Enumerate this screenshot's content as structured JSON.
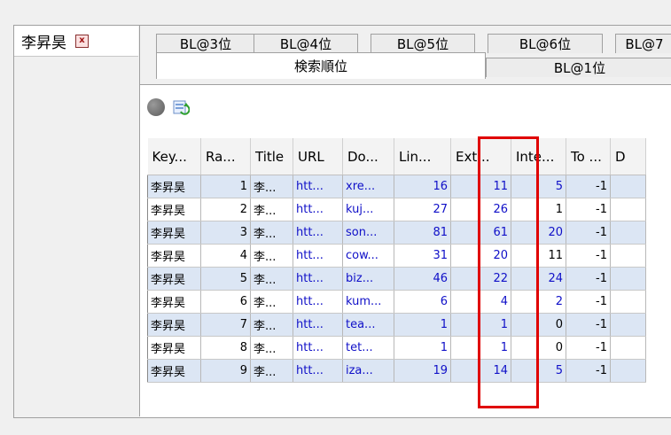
{
  "person": {
    "name": "李昇昊",
    "close_label": "x"
  },
  "tabs_row1": [
    "BL@3位",
    "BL@4位",
    "BL@5位",
    "BL@6位",
    "BL@7"
  ],
  "tabs_row2": [
    "検索順位",
    "BL@1位"
  ],
  "active_tab": "検索順位",
  "toolbar": {
    "icons": [
      "gray-circle-icon",
      "refresh-icon"
    ]
  },
  "table": {
    "columns": [
      "Key...",
      "Ra...",
      "Title",
      "URL",
      "Do...",
      "Lin...",
      "Ext...",
      "Inte...",
      "To ...",
      "D"
    ],
    "rows": [
      [
        "李昇昊",
        "1",
        "李...",
        "htt...",
        "xre...",
        "16",
        "11",
        "5",
        "-1"
      ],
      [
        "李昇昊",
        "2",
        "李...",
        "htt...",
        "kuj...",
        "27",
        "26",
        "1",
        "-1"
      ],
      [
        "李昇昊",
        "3",
        "李...",
        "htt...",
        "son...",
        "81",
        "61",
        "20",
        "-1"
      ],
      [
        "李昇昊",
        "4",
        "李...",
        "htt...",
        "cow...",
        "31",
        "20",
        "11",
        "-1"
      ],
      [
        "李昇昊",
        "5",
        "李...",
        "htt...",
        "biz...",
        "46",
        "22",
        "24",
        "-1"
      ],
      [
        "李昇昊",
        "6",
        "李...",
        "htt...",
        "kum...",
        "6",
        "4",
        "2",
        "-1"
      ],
      [
        "李昇昊",
        "7",
        "李...",
        "htt...",
        "tea...",
        "1",
        "1",
        "0",
        "-1"
      ],
      [
        "李昇昊",
        "8",
        "李...",
        "htt...",
        "tet...",
        "1",
        "1",
        "0",
        "-1"
      ],
      [
        "李昇昊",
        "9",
        "李...",
        "htt...",
        "iza...",
        "19",
        "14",
        "5",
        "-1"
      ]
    ]
  },
  "colors": {
    "highlight": "#e00000",
    "row_alt": "#dce6f4",
    "link_blue": "#1010c8"
  }
}
